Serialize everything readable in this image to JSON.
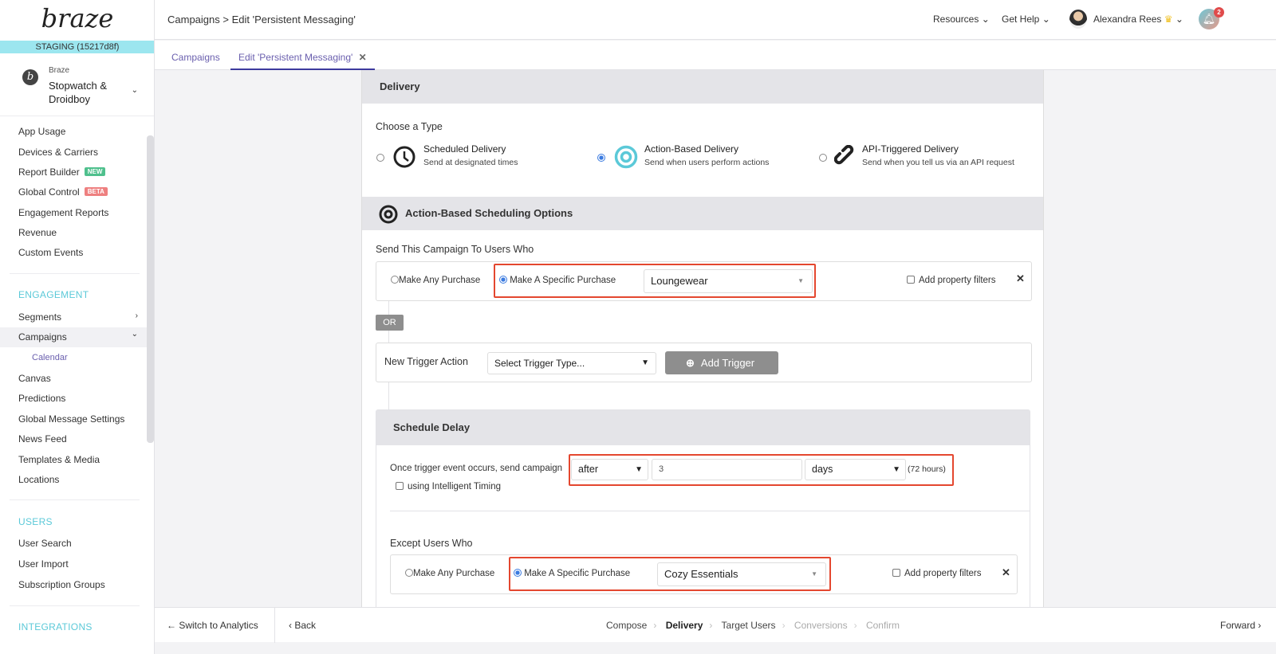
{
  "brand": {
    "logo": "braze",
    "environment": "STAGING (15217d8f)",
    "org_label": "Braze",
    "org_name": "Stopwatch & Droidboy"
  },
  "sidebar": {
    "analytics": [
      {
        "label": "App Usage"
      },
      {
        "label": "Devices & Carriers"
      },
      {
        "label": "Report Builder",
        "badge": "NEW",
        "badge_color": "#4fc08d"
      },
      {
        "label": "Global Control",
        "badge": "BETA",
        "badge_color": "#ee8080"
      },
      {
        "label": "Engagement Reports"
      },
      {
        "label": "Revenue"
      },
      {
        "label": "Custom Events"
      }
    ],
    "engagement_title": "ENGAGEMENT",
    "engagement": [
      {
        "label": "Segments"
      },
      {
        "label": "Campaigns"
      },
      {
        "label": "Calendar"
      },
      {
        "label": "Canvas"
      },
      {
        "label": "Predictions"
      },
      {
        "label": "Global Message Settings"
      },
      {
        "label": "News Feed"
      },
      {
        "label": "Templates & Media"
      },
      {
        "label": "Locations"
      }
    ],
    "users_title": "USERS",
    "users": [
      {
        "label": "User Search"
      },
      {
        "label": "User Import"
      },
      {
        "label": "Subscription Groups"
      }
    ],
    "integrations_title": "INTEGRATIONS"
  },
  "header": {
    "breadcrumb": "Campaigns > Edit 'Persistent Messaging'",
    "resources": "Resources",
    "help": "Get Help",
    "user": "Alexandra Rees",
    "notifications": "2"
  },
  "tabs": [
    {
      "label": "Campaigns"
    },
    {
      "label": "Edit 'Persistent Messaging'"
    }
  ],
  "delivery": {
    "title": "Delivery",
    "choose_type": "Choose a Type",
    "types": [
      {
        "title": "Scheduled Delivery",
        "desc": "Send at designated times",
        "selected": false,
        "icon": "clock-icon"
      },
      {
        "title": "Action-Based Delivery",
        "desc": "Send when users perform actions",
        "selected": true,
        "icon": "target-icon"
      },
      {
        "title": "API-Triggered Delivery",
        "desc": "Send when you tell us via an API request",
        "selected": false,
        "icon": "link-icon"
      }
    ],
    "action_title": "Action-Based Scheduling Options",
    "send_to": "Send This Campaign To Users Who",
    "trigger": {
      "any": "Make Any Purchase",
      "specific": "Make A Specific Purchase",
      "value": "Loungewear",
      "filters": "Add property filters"
    },
    "or": "OR",
    "new_trigger": {
      "label": "New Trigger Action",
      "placeholder": "Select Trigger Type...",
      "add": "Add Trigger"
    },
    "schedule": {
      "title": "Schedule Delay",
      "label": "Once trigger event occurs, send campaign",
      "when": "after",
      "amount": "3",
      "unit": "days",
      "hint": "(72 hours)",
      "intelligent": "using Intelligent Timing"
    },
    "except": {
      "title": "Except Users Who",
      "any": "Make Any Purchase",
      "specific": "Make A Specific Purchase",
      "value": "Cozy Essentials",
      "filters": "Add property filters"
    }
  },
  "bottom": {
    "switch": "Switch to Analytics",
    "back": "Back",
    "steps": [
      "Compose",
      "Delivery",
      "Target Users",
      "Conversions",
      "Confirm"
    ],
    "forward": "Forward"
  },
  "colors": {
    "accent": "#3d3a9e",
    "highlight": "#e4472f",
    "staging": "#9ce6ef",
    "section": "#5bc9d8"
  }
}
